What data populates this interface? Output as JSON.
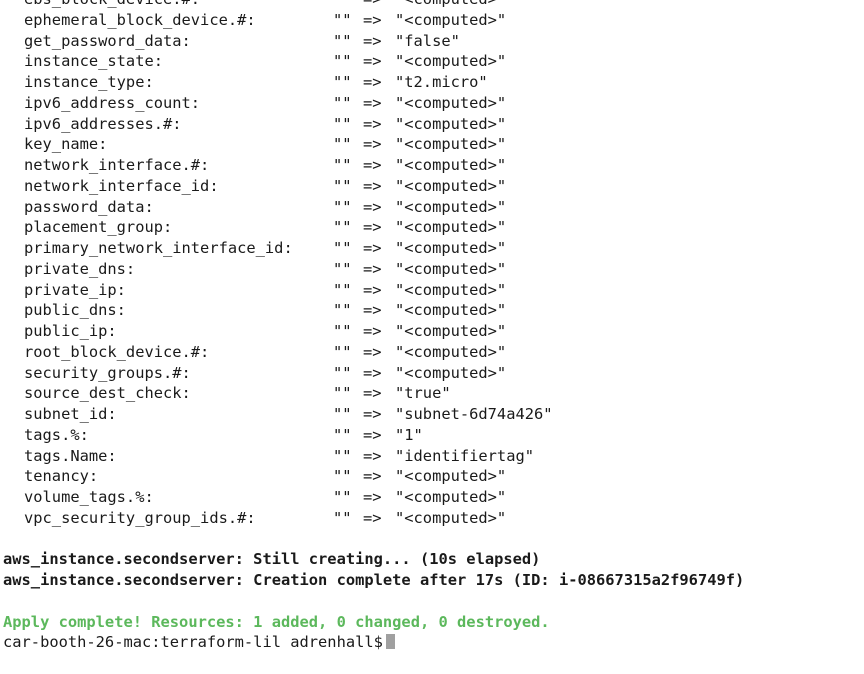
{
  "attributes": [
    {
      "name": "ebs_block_device.#:",
      "old": "\"\"",
      "arrow": "=>",
      "new": "\"<computed>\""
    },
    {
      "name": "ephemeral_block_device.#:",
      "old": "\"\"",
      "arrow": "=>",
      "new": "\"<computed>\""
    },
    {
      "name": "get_password_data:",
      "old": "\"\"",
      "arrow": "=>",
      "new": "\"false\""
    },
    {
      "name": "instance_state:",
      "old": "\"\"",
      "arrow": "=>",
      "new": "\"<computed>\""
    },
    {
      "name": "instance_type:",
      "old": "\"\"",
      "arrow": "=>",
      "new": "\"t2.micro\""
    },
    {
      "name": "ipv6_address_count:",
      "old": "\"\"",
      "arrow": "=>",
      "new": "\"<computed>\""
    },
    {
      "name": "ipv6_addresses.#:",
      "old": "\"\"",
      "arrow": "=>",
      "new": "\"<computed>\""
    },
    {
      "name": "key_name:",
      "old": "\"\"",
      "arrow": "=>",
      "new": "\"<computed>\""
    },
    {
      "name": "network_interface.#:",
      "old": "\"\"",
      "arrow": "=>",
      "new": "\"<computed>\""
    },
    {
      "name": "network_interface_id:",
      "old": "\"\"",
      "arrow": "=>",
      "new": "\"<computed>\""
    },
    {
      "name": "password_data:",
      "old": "\"\"",
      "arrow": "=>",
      "new": "\"<computed>\""
    },
    {
      "name": "placement_group:",
      "old": "\"\"",
      "arrow": "=>",
      "new": "\"<computed>\""
    },
    {
      "name": "primary_network_interface_id:",
      "old": "\"\"",
      "arrow": "=>",
      "new": "\"<computed>\""
    },
    {
      "name": "private_dns:",
      "old": "\"\"",
      "arrow": "=>",
      "new": "\"<computed>\""
    },
    {
      "name": "private_ip:",
      "old": "\"\"",
      "arrow": "=>",
      "new": "\"<computed>\""
    },
    {
      "name": "public_dns:",
      "old": "\"\"",
      "arrow": "=>",
      "new": "\"<computed>\""
    },
    {
      "name": "public_ip:",
      "old": "\"\"",
      "arrow": "=>",
      "new": "\"<computed>\""
    },
    {
      "name": "root_block_device.#:",
      "old": "\"\"",
      "arrow": "=>",
      "new": "\"<computed>\""
    },
    {
      "name": "security_groups.#:",
      "old": "\"\"",
      "arrow": "=>",
      "new": "\"<computed>\""
    },
    {
      "name": "source_dest_check:",
      "old": "\"\"",
      "arrow": "=>",
      "new": "\"true\""
    },
    {
      "name": "subnet_id:",
      "old": "\"\"",
      "arrow": "=>",
      "new": "\"subnet-6d74a426\""
    },
    {
      "name": "tags.%:",
      "old": "\"\"",
      "arrow": "=>",
      "new": "\"1\""
    },
    {
      "name": "tags.Name:",
      "old": "\"\"",
      "arrow": "=>",
      "new": "\"identifiertag\""
    },
    {
      "name": "tenancy:",
      "old": "\"\"",
      "arrow": "=>",
      "new": "\"<computed>\""
    },
    {
      "name": "volume_tags.%:",
      "old": "\"\"",
      "arrow": "=>",
      "new": "\"<computed>\""
    },
    {
      "name": "vpc_security_group_ids.#:",
      "old": "\"\"",
      "arrow": "=>",
      "new": "\"<computed>\""
    }
  ],
  "status_lines": [
    "aws_instance.secondserver: Still creating... (10s elapsed)",
    "aws_instance.secondserver: Creation complete after 17s (ID: i-08667315a2f96749f)"
  ],
  "apply_summary": "Apply complete! Resources: 1 added, 0 changed, 0 destroyed.",
  "prompt": "car-booth-26-mac:terraform-lil adrenhall$",
  "colors": {
    "text": "#1a1a1a",
    "success": "#5cb85c",
    "cursor": "#a0a0a0",
    "background": "#ffffff"
  }
}
